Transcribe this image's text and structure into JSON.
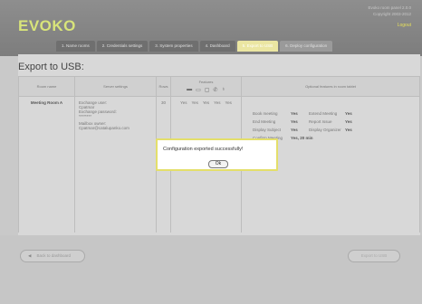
{
  "brand": {
    "logo": "EVOKO"
  },
  "header_info": {
    "line1": "Evoko room panel 2.0.0",
    "line2": "Copyright 2003-2012",
    "logout": "Logout"
  },
  "tabs": [
    {
      "label": "1. Name rooms"
    },
    {
      "label": "2. Credentials settings"
    },
    {
      "label": "3. System properties"
    },
    {
      "label": "4. Dashboard"
    },
    {
      "label": "5. Export to USB"
    },
    {
      "label": "6. Deploy configuration"
    }
  ],
  "page": {
    "title": "Export to USB:"
  },
  "table": {
    "headers": {
      "room_name": "Room name",
      "server_settings": "Server settings",
      "rows": "Rows",
      "features": "Features",
      "optional": "Optional features in room tablet"
    },
    "feature_icons": [
      "projector-icon",
      "screen-icon",
      "display-icon",
      "phone-icon",
      "lock-icon"
    ],
    "row": {
      "room": "Meeting Room A",
      "server": [
        "Exchange user:",
        "Cpatmar",
        "Exchange password:",
        "********",
        "Mailbox owner:",
        "Cpatmar@catalupanko.com"
      ],
      "rows_val": "30",
      "feature_vals": [
        "Yes",
        "Yes",
        "Yes",
        "Yes",
        "Yes"
      ],
      "optional": [
        {
          "label": "Book meeting",
          "value": "Yes"
        },
        {
          "label": "Extend Meeting",
          "value": "Yes"
        },
        {
          "label": "End Meeting",
          "value": "Yes"
        },
        {
          "label": "Report Issue",
          "value": "Yes"
        },
        {
          "label": "Display Subject",
          "value": "Yes"
        },
        {
          "label": "Display Organizer",
          "value": "Yes"
        },
        {
          "label": "Confirm Meeting",
          "value": "Yes, 20 min"
        }
      ]
    }
  },
  "footer": {
    "back": "Back to dashboard",
    "next": "Export to USB"
  },
  "dialog": {
    "message": "Configuration exported successfully!",
    "ok": "Ok"
  }
}
